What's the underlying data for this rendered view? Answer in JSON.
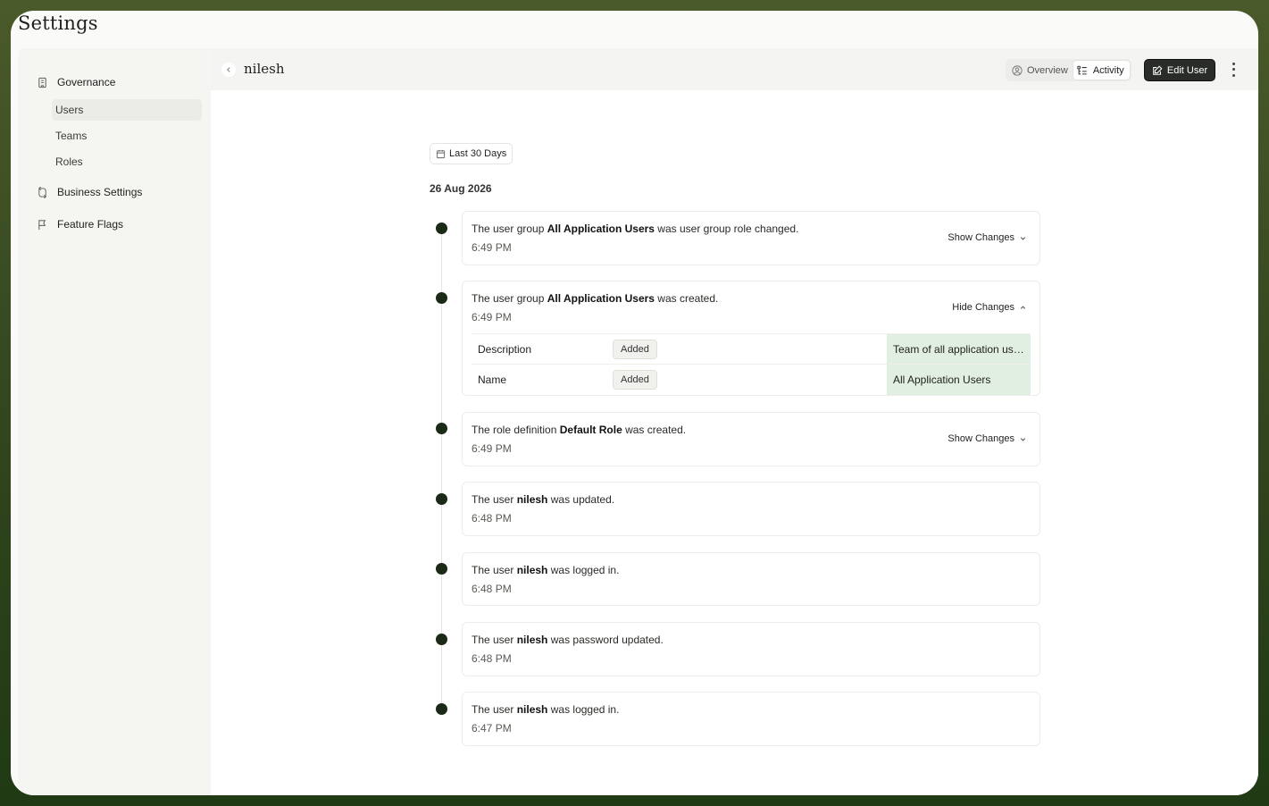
{
  "app": {
    "title": "Settings"
  },
  "sidebar": {
    "groups": [
      {
        "label": "Governance",
        "icon": "building-icon",
        "expanded": true,
        "items": [
          {
            "label": "Users",
            "active": true
          },
          {
            "label": "Teams"
          },
          {
            "label": "Roles"
          }
        ]
      },
      {
        "label": "Business Settings",
        "icon": "arrows-icon",
        "expanded": false,
        "items": []
      },
      {
        "label": "Feature Flags",
        "icon": "flag-icon",
        "items": []
      }
    ]
  },
  "header": {
    "title": "nilesh",
    "tabs": [
      {
        "label": "Overview",
        "icon": "user-circle-icon"
      },
      {
        "label": "Activity",
        "icon": "list-icon",
        "active": true
      }
    ],
    "edit_label": "Edit User"
  },
  "filter": {
    "range_label": "Last 30 Days"
  },
  "activity": {
    "date": "26 Aug 2026",
    "entries": [
      {
        "prefix": "The user group ",
        "subject": "All Application Users",
        "suffix": " was user group role changed.",
        "time": "6:49 PM",
        "toggle": "Show Changes"
      },
      {
        "prefix": "The user group ",
        "subject": "All Application Users",
        "suffix": " was created.",
        "time": "6:49 PM",
        "toggle": "Hide Changes",
        "changes": [
          {
            "field": "Description",
            "action": "Added",
            "value": "Team of all application users"
          },
          {
            "field": "Name",
            "action": "Added",
            "value": "All Application Users"
          }
        ]
      },
      {
        "prefix": "The role definition ",
        "subject": "Default Role",
        "suffix": " was created.",
        "time": "6:49 PM",
        "toggle": "Show Changes"
      },
      {
        "prefix": "The user ",
        "subject": "nilesh",
        "suffix": " was updated.",
        "time": "6:48 PM"
      },
      {
        "prefix": "The user ",
        "subject": "nilesh",
        "suffix": " was logged in.",
        "time": "6:48 PM"
      },
      {
        "prefix": "The user ",
        "subject": "nilesh",
        "suffix": " was password updated.",
        "time": "6:48 PM"
      },
      {
        "prefix": "The user ",
        "subject": "nilesh",
        "suffix": " was logged in.",
        "time": "6:47 PM"
      }
    ]
  },
  "colors": {
    "accent_dark": "#2a2c28",
    "dot": "#1a2a16",
    "added_bg": "#e1efe3"
  }
}
